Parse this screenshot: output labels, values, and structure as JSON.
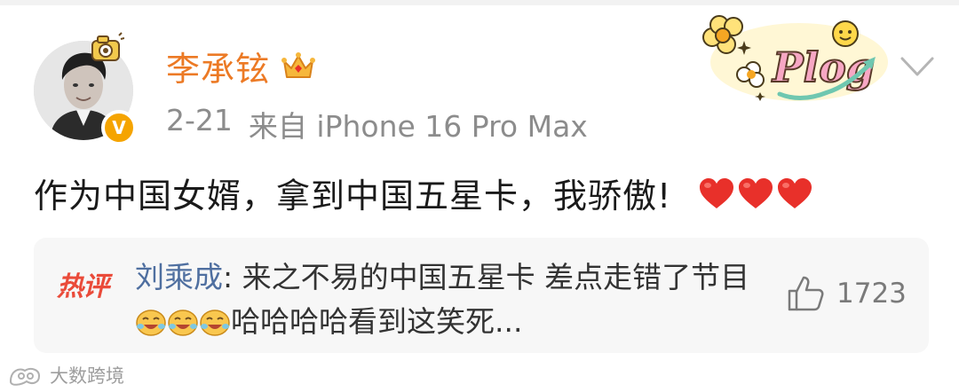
{
  "post": {
    "username": "李承铉",
    "time": "2-21",
    "source": "来自 iPhone 16 Pro Max",
    "text": "作为中国女婿，拿到中国五星卡，我骄傲!",
    "hearts": [
      "heart-icon",
      "heart-icon",
      "heart-icon"
    ],
    "sticker": "Plog",
    "verified_badge": "V"
  },
  "hot_comment": {
    "badge": "热评",
    "commenter": "刘乘成",
    "separator": ":",
    "text_before": " 来之不易的中国五星卡 差点走错了节目",
    "emojis": [
      "laughing-face-icon",
      "laughing-face-icon",
      "laughing-face-icon"
    ],
    "text_after": "哈哈哈哈看到这笑死...",
    "likes": "1723"
  },
  "watermark": {
    "text": "大数跨境"
  },
  "colors": {
    "username": "#ec7a25",
    "badge": "#f5a400",
    "hot_badge": "#ea4b3a",
    "commenter": "#4f6fa0",
    "heart": "#e8302a"
  }
}
